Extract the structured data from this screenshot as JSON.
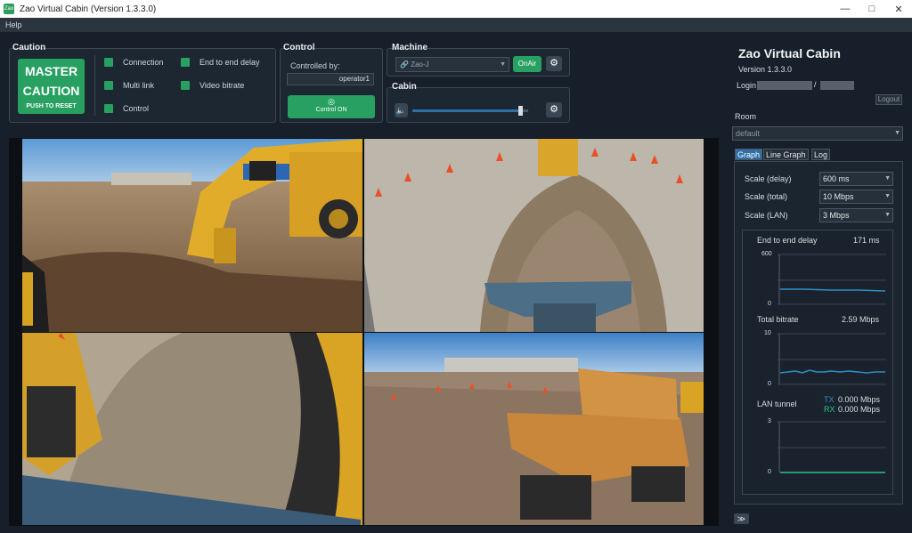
{
  "window": {
    "title": "Zao Virtual Cabin (Version 1.3.3.0)",
    "icon_text": "Zao"
  },
  "menu": {
    "help": "Help"
  },
  "caution": {
    "title": "Caution",
    "master_line1": "MASTER",
    "master_line2": "CAUTION",
    "push_reset": "PUSH TO RESET",
    "indicators": [
      "Connection",
      "End to end delay",
      "Multi link",
      "Video bitrate",
      "Control"
    ]
  },
  "control": {
    "title": "Control",
    "controlled_by_label": "Controlled by:",
    "controlled_by_value": "operator1",
    "button": "Control ON"
  },
  "machine": {
    "title": "Machine",
    "selected": "Zao-J",
    "onair": "OnAir"
  },
  "cabin": {
    "title": "Cabin",
    "volume": 0.93
  },
  "sidebar": {
    "app_title": "Zao Virtual Cabin",
    "version": "Version 1.3.3.0",
    "login_label": "Login",
    "logout": "Logout",
    "room_label": "Room",
    "room_value": "default",
    "tabs": [
      "Graph",
      "Line Graph",
      "Log"
    ],
    "scales": [
      {
        "label": "Scale (delay)",
        "value": "600 ms"
      },
      {
        "label": "Scale (total)",
        "value": "10 Mbps"
      },
      {
        "label": "Scale (LAN)",
        "value": "3 Mbps"
      }
    ],
    "graphs": {
      "delay": {
        "title": "End to end delay",
        "value": "171 ms",
        "ymax": "600",
        "ymin": "0"
      },
      "bitrate": {
        "title": "Total bitrate",
        "value": "2.59 Mbps",
        "ymax": "10",
        "ymin": "0"
      },
      "lan": {
        "title": "LAN tunnel",
        "tx_label": "TX",
        "tx_value": "0.000 Mbps",
        "rx_label": "RX",
        "rx_value": "0.000 Mbps",
        "ymax": "3",
        "ymin": "0"
      }
    },
    "expand": "≫"
  },
  "colors": {
    "accent_green": "#27a061",
    "tab_blue": "#2f6fa8",
    "graph_line": "#2e8fc4",
    "lan_line": "#2bbf8a"
  }
}
